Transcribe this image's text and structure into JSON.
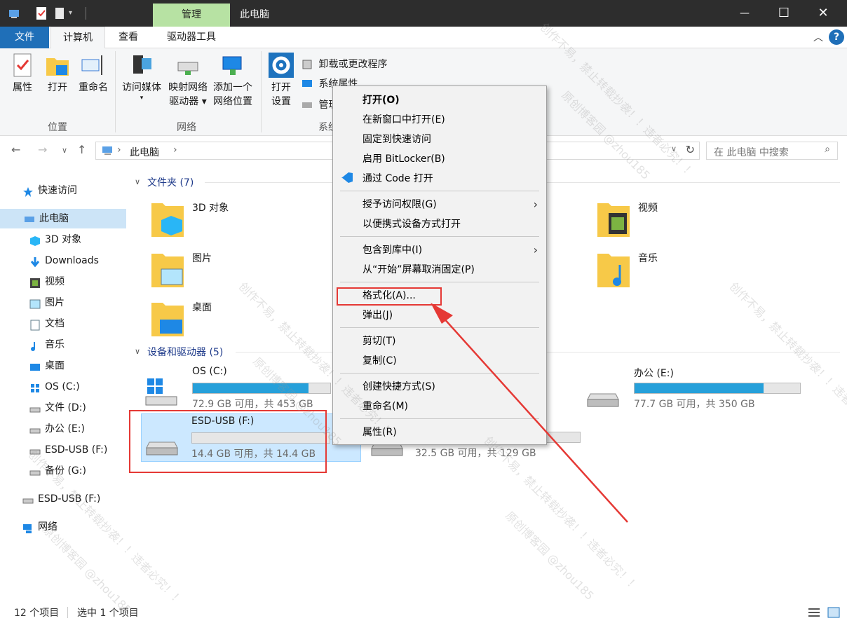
{
  "titlebar": {
    "context_tab": "管理",
    "title": "此电脑",
    "minimize": "—",
    "maximize": "☐",
    "close": "✕"
  },
  "tabs": [
    "文件",
    "计算机",
    "查看",
    "驱动器工具"
  ],
  "ribbon": {
    "location": {
      "label": "位置",
      "buttons": [
        "属性",
        "打开",
        "重命名"
      ]
    },
    "network": {
      "label": "网络",
      "buttons": [
        {
          "line1": "访问媒体",
          "line2": "▾"
        },
        {
          "line1": "映射网络",
          "line2": "驱动器 ▾"
        },
        {
          "line1": "添加一个",
          "line2": "网络位置"
        }
      ]
    },
    "system": {
      "label": "系统",
      "open_line1": "打开",
      "open_line2": "设置",
      "commands": [
        "卸载或更改程序",
        "系统属性",
        "管理"
      ]
    }
  },
  "address": {
    "path": "此电脑",
    "search_placeholder": "在 此电脑 中搜索"
  },
  "sidebar": [
    {
      "label": "快速访问",
      "icon": "star-icon"
    },
    {
      "label": "此电脑",
      "icon": "computer-icon"
    },
    {
      "label": "3D 对象",
      "icon": "cube-icon"
    },
    {
      "label": "Downloads",
      "icon": "download-icon"
    },
    {
      "label": "视频",
      "icon": "video-icon"
    },
    {
      "label": "图片",
      "icon": "picture-icon"
    },
    {
      "label": "文档",
      "icon": "document-icon"
    },
    {
      "label": "音乐",
      "icon": "music-icon"
    },
    {
      "label": "桌面",
      "icon": "desktop-icon"
    },
    {
      "label": "OS (C:)",
      "icon": "windows-drive-icon"
    },
    {
      "label": "文件 (D:)",
      "icon": "drive-icon"
    },
    {
      "label": "办公 (E:)",
      "icon": "drive-icon"
    },
    {
      "label": "ESD-USB (F:)",
      "icon": "drive-icon"
    },
    {
      "label": "备份 (G:)",
      "icon": "drive-icon"
    },
    {
      "label": "ESD-USB (F:)",
      "icon": "usb-drive-icon"
    },
    {
      "label": "网络",
      "icon": "network-icon"
    }
  ],
  "content": {
    "folders_header": "文件夹 (7)",
    "devices_header": "设备和驱动器 (5)",
    "folders": [
      {
        "name": "3D 对象"
      },
      {
        "name": "视频"
      },
      {
        "name": "图片"
      },
      {
        "name": "音乐"
      },
      {
        "name": "桌面"
      }
    ],
    "drives": [
      {
        "name": "OS (C:)",
        "size": "72.9 GB 可用，共 453 GB",
        "used": 0.84
      },
      {
        "name": "办公 (E:)",
        "size": "77.7 GB 可用，共 350 GB",
        "used": 0.78
      },
      {
        "name": "ESD-USB (F:)",
        "size": "14.4 GB 可用，共 14.4 GB",
        "used": 0.0
      },
      {
        "name": "",
        "size": "32.5 GB 可用，共 129 GB",
        "used": 0.75
      }
    ]
  },
  "context_menu": {
    "items": [
      "打开(O)",
      "在新窗口中打开(E)",
      "固定到快速访问",
      "启用 BitLocker(B)",
      "通过 Code 打开",
      "授予访问权限(G)",
      "以便携式设备方式打开",
      "包含到库中(I)",
      "从“开始”屏幕取消固定(P)",
      "格式化(A)...",
      "弹出(J)",
      "剪切(T)",
      "复制(C)",
      "创建快捷方式(S)",
      "重命名(M)",
      "属性(R)"
    ]
  },
  "status": {
    "count": "12 个项目",
    "selected": "选中 1 个项目"
  },
  "watermarks": [
    "创作不易，禁止转载抄袭！！违者必究！！",
    "原创博客园 @zhou185"
  ],
  "colors": {
    "accent": "#1f6fb8",
    "manage_tab": "#b7e2a3",
    "drive_bar": "#26a0da",
    "annotation": "#e53935"
  }
}
